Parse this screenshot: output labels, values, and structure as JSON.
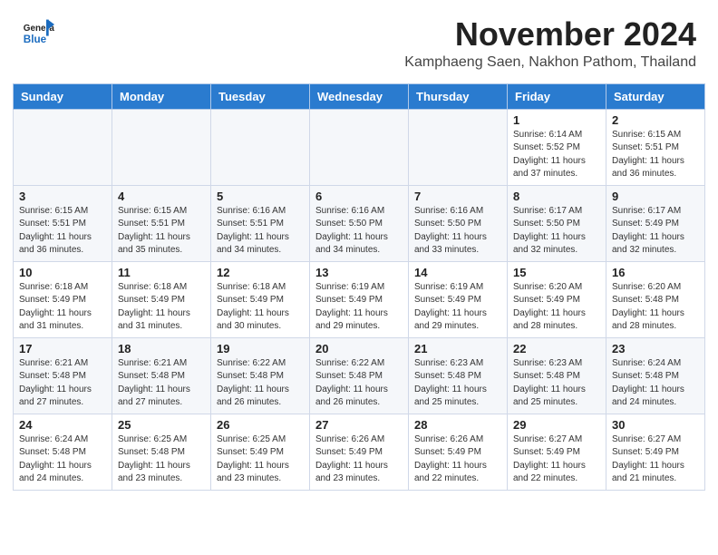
{
  "header": {
    "logo_line1": "General",
    "logo_line2": "Blue",
    "month": "November 2024",
    "location": "Kamphaeng Saen, Nakhon Pathom, Thailand"
  },
  "days_of_week": [
    "Sunday",
    "Monday",
    "Tuesday",
    "Wednesday",
    "Thursday",
    "Friday",
    "Saturday"
  ],
  "weeks": [
    [
      {
        "day": "",
        "info": ""
      },
      {
        "day": "",
        "info": ""
      },
      {
        "day": "",
        "info": ""
      },
      {
        "day": "",
        "info": ""
      },
      {
        "day": "",
        "info": ""
      },
      {
        "day": "1",
        "info": "Sunrise: 6:14 AM\nSunset: 5:52 PM\nDaylight: 11 hours\nand 37 minutes."
      },
      {
        "day": "2",
        "info": "Sunrise: 6:15 AM\nSunset: 5:51 PM\nDaylight: 11 hours\nand 36 minutes."
      }
    ],
    [
      {
        "day": "3",
        "info": "Sunrise: 6:15 AM\nSunset: 5:51 PM\nDaylight: 11 hours\nand 36 minutes."
      },
      {
        "day": "4",
        "info": "Sunrise: 6:15 AM\nSunset: 5:51 PM\nDaylight: 11 hours\nand 35 minutes."
      },
      {
        "day": "5",
        "info": "Sunrise: 6:16 AM\nSunset: 5:51 PM\nDaylight: 11 hours\nand 34 minutes."
      },
      {
        "day": "6",
        "info": "Sunrise: 6:16 AM\nSunset: 5:50 PM\nDaylight: 11 hours\nand 34 minutes."
      },
      {
        "day": "7",
        "info": "Sunrise: 6:16 AM\nSunset: 5:50 PM\nDaylight: 11 hours\nand 33 minutes."
      },
      {
        "day": "8",
        "info": "Sunrise: 6:17 AM\nSunset: 5:50 PM\nDaylight: 11 hours\nand 32 minutes."
      },
      {
        "day": "9",
        "info": "Sunrise: 6:17 AM\nSunset: 5:49 PM\nDaylight: 11 hours\nand 32 minutes."
      }
    ],
    [
      {
        "day": "10",
        "info": "Sunrise: 6:18 AM\nSunset: 5:49 PM\nDaylight: 11 hours\nand 31 minutes."
      },
      {
        "day": "11",
        "info": "Sunrise: 6:18 AM\nSunset: 5:49 PM\nDaylight: 11 hours\nand 31 minutes."
      },
      {
        "day": "12",
        "info": "Sunrise: 6:18 AM\nSunset: 5:49 PM\nDaylight: 11 hours\nand 30 minutes."
      },
      {
        "day": "13",
        "info": "Sunrise: 6:19 AM\nSunset: 5:49 PM\nDaylight: 11 hours\nand 29 minutes."
      },
      {
        "day": "14",
        "info": "Sunrise: 6:19 AM\nSunset: 5:49 PM\nDaylight: 11 hours\nand 29 minutes."
      },
      {
        "day": "15",
        "info": "Sunrise: 6:20 AM\nSunset: 5:49 PM\nDaylight: 11 hours\nand 28 minutes."
      },
      {
        "day": "16",
        "info": "Sunrise: 6:20 AM\nSunset: 5:48 PM\nDaylight: 11 hours\nand 28 minutes."
      }
    ],
    [
      {
        "day": "17",
        "info": "Sunrise: 6:21 AM\nSunset: 5:48 PM\nDaylight: 11 hours\nand 27 minutes."
      },
      {
        "day": "18",
        "info": "Sunrise: 6:21 AM\nSunset: 5:48 PM\nDaylight: 11 hours\nand 27 minutes."
      },
      {
        "day": "19",
        "info": "Sunrise: 6:22 AM\nSunset: 5:48 PM\nDaylight: 11 hours\nand 26 minutes."
      },
      {
        "day": "20",
        "info": "Sunrise: 6:22 AM\nSunset: 5:48 PM\nDaylight: 11 hours\nand 26 minutes."
      },
      {
        "day": "21",
        "info": "Sunrise: 6:23 AM\nSunset: 5:48 PM\nDaylight: 11 hours\nand 25 minutes."
      },
      {
        "day": "22",
        "info": "Sunrise: 6:23 AM\nSunset: 5:48 PM\nDaylight: 11 hours\nand 25 minutes."
      },
      {
        "day": "23",
        "info": "Sunrise: 6:24 AM\nSunset: 5:48 PM\nDaylight: 11 hours\nand 24 minutes."
      }
    ],
    [
      {
        "day": "24",
        "info": "Sunrise: 6:24 AM\nSunset: 5:48 PM\nDaylight: 11 hours\nand 24 minutes."
      },
      {
        "day": "25",
        "info": "Sunrise: 6:25 AM\nSunset: 5:48 PM\nDaylight: 11 hours\nand 23 minutes."
      },
      {
        "day": "26",
        "info": "Sunrise: 6:25 AM\nSunset: 5:49 PM\nDaylight: 11 hours\nand 23 minutes."
      },
      {
        "day": "27",
        "info": "Sunrise: 6:26 AM\nSunset: 5:49 PM\nDaylight: 11 hours\nand 23 minutes."
      },
      {
        "day": "28",
        "info": "Sunrise: 6:26 AM\nSunset: 5:49 PM\nDaylight: 11 hours\nand 22 minutes."
      },
      {
        "day": "29",
        "info": "Sunrise: 6:27 AM\nSunset: 5:49 PM\nDaylight: 11 hours\nand 22 minutes."
      },
      {
        "day": "30",
        "info": "Sunrise: 6:27 AM\nSunset: 5:49 PM\nDaylight: 11 hours\nand 21 minutes."
      }
    ]
  ]
}
